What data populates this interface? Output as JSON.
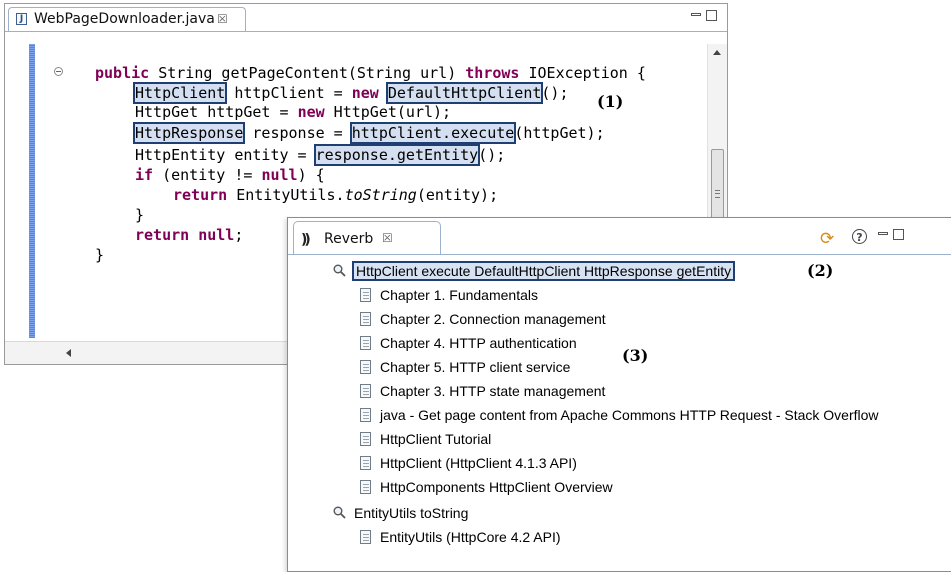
{
  "editor": {
    "tab_title": "WebPageDownloader.java",
    "close_glyph": "☒",
    "code": {
      "line1_kw1": "public",
      "line1_rest1": " String getPageContent(String url) ",
      "line1_kw2": "throws",
      "line1_rest2": " IOException {",
      "line2_hl1": "HttpClient",
      "line2_mid": " httpClient = ",
      "line2_kw": "new",
      "line2_space": " ",
      "line2_hl2": "DefaultHttpClient",
      "line2_end": "();",
      "line3_a": "HttpGet httpGet = ",
      "line3_kw": "new",
      "line3_b": " HttpGet(url);",
      "line4_hl1": "HttpResponse",
      "line4_mid": " response = ",
      "line4_hl2": "httpClient.execute",
      "line4_end": "(httpGet);",
      "line5_a": "HttpEntity entity = ",
      "line5_hl": "response.getEntity",
      "line5_end": "();",
      "line6_kw": "if",
      "line6_rest": " (entity != ",
      "line6_kw2": "null",
      "line6_end": ") {",
      "line7_kw": "return",
      "line7_a": " EntityUtils.",
      "line7_it": "toString",
      "line7_end": "(entity);",
      "line8": "}",
      "line9_kw": "return",
      "line9_sp": " ",
      "line9_kw2": "null",
      "line9_end": ";",
      "line10": "}"
    }
  },
  "annotations": {
    "one": "(1)",
    "two": "(2)",
    "three": "(3)"
  },
  "reverb": {
    "tab_title": "Reverb",
    "close_glyph": "☒",
    "logo_glyph": "))",
    "help_glyph": "?",
    "sync_glyph": "⟳",
    "queries": [
      {
        "label": "HttpClient execute DefaultHttpClient HttpResponse getEntity",
        "results": [
          "Chapter 1. Fundamentals",
          "Chapter 2. Connection management",
          "Chapter 4. HTTP authentication",
          "Chapter 5. HTTP client service",
          "Chapter 3. HTTP state management",
          "java - Get page content from Apache Commons HTTP Request - Stack Overflow",
          "HttpClient Tutorial",
          "HttpClient (HttpClient 4.1.3 API)",
          "HttpComponents HttpClient Overview"
        ]
      },
      {
        "label": "EntityUtils toString",
        "results": [
          "EntityUtils (HttpCore 4.2 API)"
        ]
      }
    ]
  }
}
